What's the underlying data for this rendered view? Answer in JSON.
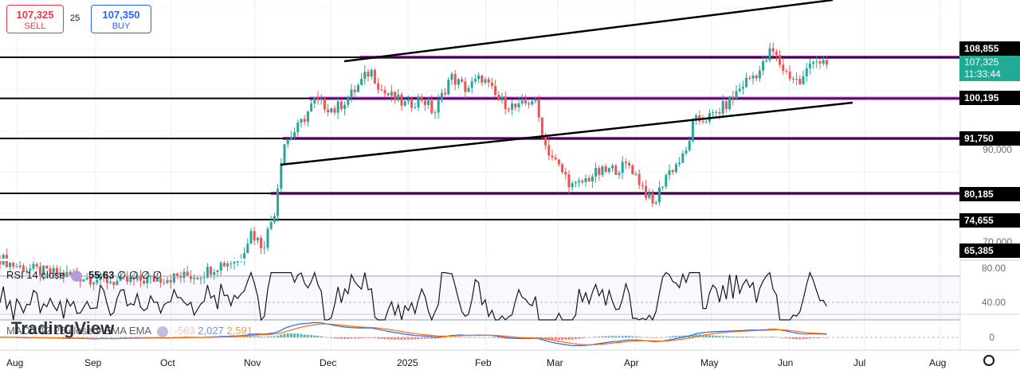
{
  "trade_panel": {
    "sell_price": "107,325",
    "sell_label": "SELL",
    "spread": "25",
    "buy_price": "107,350",
    "buy_label": "BUY"
  },
  "price_tags": [
    {
      "value": "108,855"
    },
    {
      "value": "100,195"
    },
    {
      "value": "91,750"
    },
    {
      "value": "80,185"
    },
    {
      "value": "74,655"
    },
    {
      "value": "65,385"
    }
  ],
  "current_price": {
    "value": "107,325",
    "countdown": "11:33:44"
  },
  "price_axis_labels": [
    "90,000",
    "70,000"
  ],
  "rsi": {
    "label": "RSI 14 close",
    "value": "55.63",
    "placeholders": "∅ ∅ ∅ ∅",
    "levels": [
      "80.00",
      "40.00"
    ]
  },
  "macd": {
    "label": "MACD 12 26 close 9 EMA EMA",
    "hist": "-563",
    "macd": "2,027",
    "signal": "2,591",
    "zero_label": "0"
  },
  "watermark": "TradingView",
  "x_axis": [
    "Aug",
    "Sep",
    "Oct",
    "Nov",
    "Dec",
    "2025",
    "Feb",
    "Mar",
    "Apr",
    "May",
    "Jun",
    "Jul",
    "Aug"
  ],
  "colors": {
    "up": "#26a69a",
    "down": "#ef5350",
    "rsi": "#131722",
    "macd": "#2962ff",
    "signal": "#ff6d00",
    "hline": "#000000",
    "purple": "#9c27b0"
  },
  "chart_data": {
    "type": "candlestick",
    "x": [
      "Aug",
      "Sep",
      "Oct",
      "Nov",
      "Dec",
      "2025",
      "Feb",
      "Mar",
      "Apr",
      "May",
      "Jun",
      "Jul",
      "Aug"
    ],
    "horizontal_levels": [
      108855,
      100195,
      91750,
      80185,
      74655,
      65385
    ],
    "last_close": 107325,
    "indicators": [
      "RSI 14 close",
      "MACD 12 26 close 9"
    ]
  }
}
